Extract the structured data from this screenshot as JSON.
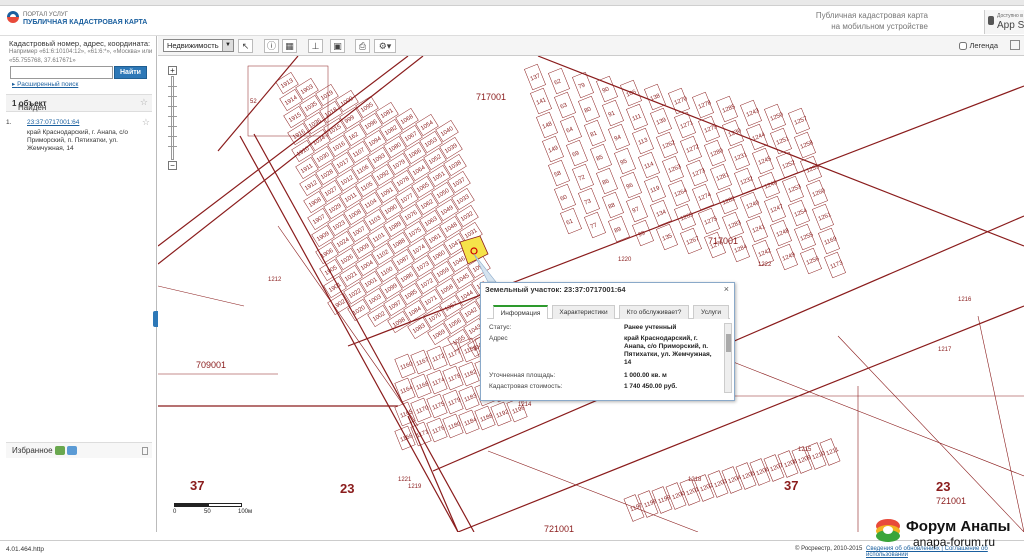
{
  "header": {
    "portal_label": "ПОРТАЛ УСЛУГ",
    "portal_title": "ПУБЛИЧНАЯ КАДАСТРОВАЯ КАРТА",
    "mobile_line1": "Публичная кадастровая карта",
    "mobile_line2": "на мобильном устройстве",
    "appstore_small": "Доступно в",
    "appstore_big": "App Store"
  },
  "sidebar": {
    "search_hint": "Кадастровый номер, адрес, координата:",
    "search_example": "Например «61:6:10104:12», «61:6:*», «Москва» или «55.755768, 37.617671»",
    "search_value": "",
    "search_button": "Найти",
    "advanced_search": "Расширенный поиск",
    "results_prefix": "Найден",
    "results_count": "1 объект",
    "result": {
      "num": "1.",
      "cad_number": "23:37:0717001:64",
      "address": "край Краснодарский, г. Анапа, с/о Приморский, п. Пятихатки, ул. Жемчужная, 14"
    },
    "favorites_label": "Избранное"
  },
  "toolbar": {
    "layer_select": "Недвижимость",
    "legend_label": "Легенда"
  },
  "map": {
    "parcel_labels": [
      "52",
      "1913",
      "1914",
      "1915",
      "1916",
      "1910",
      "1911",
      "1912",
      "1908",
      "1907",
      "1909",
      "1906",
      "1905",
      "1901",
      "1902",
      "1903",
      "1035",
      "1036",
      "1034",
      "1030",
      "1028",
      "1027",
      "1029",
      "1023",
      "1024",
      "1026",
      "1021",
      "1022",
      "1020",
      "1019",
      "1018",
      "1015",
      "1016",
      "1017",
      "1012",
      "1011",
      "1008",
      "1007",
      "1009",
      "1004",
      "1001",
      "1003",
      "1002",
      "1000",
      "999",
      "162",
      "1107",
      "1106",
      "1105",
      "1104",
      "1103",
      "1101",
      "1102",
      "1100",
      "1099",
      "1097",
      "1098",
      "1095",
      "1096",
      "1094",
      "1093",
      "1092",
      "1091",
      "1090",
      "1089",
      "1088",
      "1087",
      "1086",
      "1085",
      "1084",
      "1083",
      "1081",
      "1082",
      "1080",
      "1079",
      "1078",
      "1077",
      "1076",
      "1075",
      "1074",
      "1073",
      "1072",
      "1071",
      "1070",
      "1069",
      "1068",
      "1067",
      "1066",
      "1064",
      "1065",
      "1062",
      "1063",
      "1061",
      "1060",
      "1059",
      "1058",
      "1057",
      "1056",
      "1055",
      "1054",
      "1053",
      "1052",
      "1051",
      "1050",
      "1049",
      "1048",
      "1047",
      "1046",
      "1045",
      "1044",
      "1042",
      "1043",
      "1041",
      "1040",
      "1039",
      "1038",
      "1037",
      "1033",
      "1032",
      "1031",
      "110",
      "109",
      "115",
      "116",
      "117",
      "118",
      "125",
      "137",
      "141",
      "148",
      "149",
      "58",
      "60",
      "61",
      "62",
      "63",
      "64",
      "69",
      "72",
      "73",
      "77",
      "79",
      "80",
      "81",
      "85",
      "86",
      "88",
      "89",
      "90",
      "91",
      "94",
      "95",
      "96",
      "97",
      "99",
      "106",
      "111",
      "113",
      "114",
      "119",
      "134",
      "135",
      "138",
      "139",
      "1262",
      "1263",
      "1264",
      "1265",
      "1267",
      "1270",
      "1271",
      "1272",
      "1273",
      "1274",
      "1275",
      "1276",
      "1278",
      "1279",
      "1280",
      "1281",
      "1282",
      "1283",
      "1284",
      "1285",
      "1230",
      "1231",
      "1232",
      "1240",
      "1241",
      "1242",
      "1243",
      "1244",
      "1245",
      "1246",
      "1247",
      "1248",
      "1249",
      "1250",
      "1251",
      "1252",
      "1253",
      "1254",
      "1255",
      "1256",
      "1257",
      "1258",
      "1259",
      "1260",
      "1261",
      "1169",
      "1173",
      "1160",
      "1164",
      "1165",
      "1166",
      "1167",
      "1168",
      "1170",
      "1171",
      "1172",
      "1174",
      "1175",
      "1176",
      "1177",
      "1178",
      "1179",
      "1180",
      "1181",
      "1182",
      "1183",
      "1184",
      "1185",
      "1186",
      "1187",
      "1188",
      "1189",
      "1190",
      "1191",
      "1192",
      "1193",
      "1194",
      "1195",
      "1196",
      "1197",
      "1198",
      "1199",
      "1200",
      "1201",
      "1202",
      "1203",
      "1204",
      "1205",
      "1206",
      "1207",
      "1208",
      "1209",
      "1210",
      "1211",
      "1212",
      "1213",
      "1214",
      "1215",
      "1216",
      "1217",
      "1218",
      "1219",
      "1220",
      "1221",
      "1222",
      "1223",
      "1224",
      "1225",
      "1226",
      "1227",
      "1228",
      "1229",
      "1139",
      "1140",
      "1141",
      "1142",
      "1143",
      "1144",
      "1145",
      "1146",
      "1147",
      "1148",
      "1149",
      "1150",
      "1151",
      "1152",
      "1153",
      "1154",
      "1155",
      "1156",
      "1157",
      "1158",
      "1159",
      "1161",
      "1162",
      "1163",
      "1129",
      "1130",
      "1131",
      "1132",
      "1133",
      "1134",
      "1135",
      "1136",
      "1137",
      "1138",
      "1120",
      "1121",
      "1122",
      "1123",
      "1124",
      "1125",
      "1126",
      "1127",
      "1128",
      "1111",
      "1112",
      "1113",
      "1114",
      "1115",
      "1116",
      "1117",
      "1118",
      "1119",
      "1108",
      "1109",
      "1110",
      "211",
      "215",
      "216",
      "217",
      "218",
      "219",
      "270",
      "269",
      "271",
      "272",
      "273",
      "274",
      "458",
      "460",
      "446",
      "451",
      "452",
      "453",
      "454",
      "456",
      "457",
      "459",
      "461",
      "462",
      "463",
      "464",
      "465",
      "466",
      "467",
      "468",
      "469",
      "470",
      "471",
      "472",
      "473",
      "474",
      "475",
      "476",
      "477",
      "478",
      "479",
      "480",
      "15",
      "49",
      "63",
      "65",
      "67",
      "83",
      "158",
      "6229",
      "287",
      "1460",
      "1465",
      "1466",
      "1467",
      "1468",
      "1469",
      "1470",
      "1471",
      "1472",
      "1473",
      "1474",
      "1475",
      "1476",
      "1477",
      "1478",
      "1479"
    ],
    "block_labels": [
      "23",
      "37",
      "23",
      "37"
    ],
    "quarter_labels": [
      "717001",
      "717001",
      "709001",
      "721001",
      "721001"
    ],
    "scale_labels": [
      "0",
      "50",
      "100м"
    ]
  },
  "popup": {
    "title": "Земельный участок: 23:37:0717001:64",
    "tabs": [
      "Информация",
      "Характеристики",
      "Кто обслуживает?",
      "Услуги"
    ],
    "rows": [
      {
        "label": "Статус:",
        "value": "Ранее учтенный"
      },
      {
        "label": "Адрес",
        "value": "край Краснодарский, г. Анапа, с/о Приморский, п. Пятихатки, ул. Жемчужная, 14"
      },
      {
        "label": "Уточненная площадь:",
        "value": "1 000.00 кв. м"
      },
      {
        "label": "Кадастровая стоимость:",
        "value": "1 740 450.00 руб."
      }
    ]
  },
  "status": {
    "version": "4.01.464.http",
    "copyright": "© Росреестр, 2010-2015",
    "links": "Сведения об обновлениях | Соглашение об использовании"
  },
  "watermark": {
    "name": "Форум Анапы",
    "url": "anapa-forum.ru"
  },
  "colors": {
    "accent_blue": "#2d78b7",
    "parcel_line": "#8a1c1c",
    "selected_parcel": "#f5e34a"
  }
}
